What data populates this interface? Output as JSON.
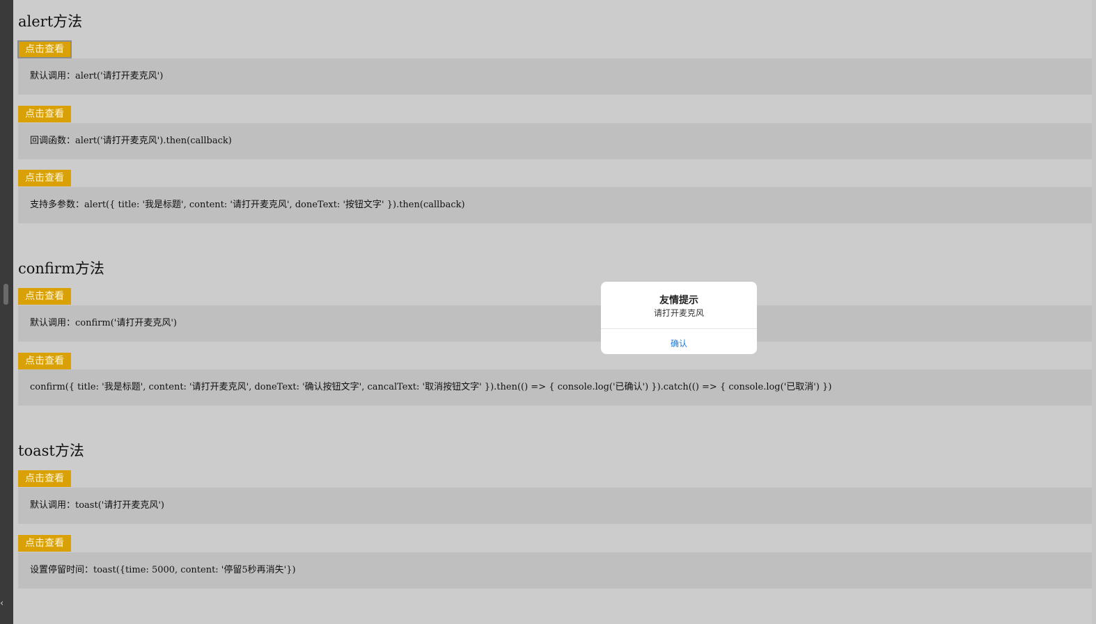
{
  "sections": [
    {
      "title": "alert方法",
      "demos": [
        {
          "button": "点击查看",
          "code": "默认调用：alert('请打开麦克风')"
        },
        {
          "button": "点击查看",
          "code": "回调函数：alert('请打开麦克风').then(callback)"
        },
        {
          "button": "点击查看",
          "code": "支持多参数：alert({ title: '我是标题', content: '请打开麦克风', doneText: '按钮文字' }).then(callback)"
        }
      ]
    },
    {
      "title": "confirm方法",
      "demos": [
        {
          "button": "点击查看",
          "code": "默认调用：confirm('请打开麦克风')"
        },
        {
          "button": "点击查看",
          "code": "confirm({ title: '我是标题', content: '请打开麦克风', doneText: '确认按钮文字', cancalText: '取消按钮文字' }).then(() => { console.log('已确认') }).catch(() => { console.log('已取消') })"
        }
      ]
    },
    {
      "title": "toast方法",
      "demos": [
        {
          "button": "点击查看",
          "code": "默认调用：toast('请打开麦克风')"
        },
        {
          "button": "点击查看",
          "code": "设置停留时间：toast({time: 5000, content: '停留5秒再消失'})"
        }
      ]
    }
  ],
  "dialog": {
    "title": "友情提示",
    "content": "请打开麦克风",
    "confirm_label": "确认"
  },
  "icons": {
    "collapse": "chevron-left-icon"
  },
  "colors": {
    "button_bg": "#d9a106",
    "dialog_link": "#1a7ad6"
  }
}
